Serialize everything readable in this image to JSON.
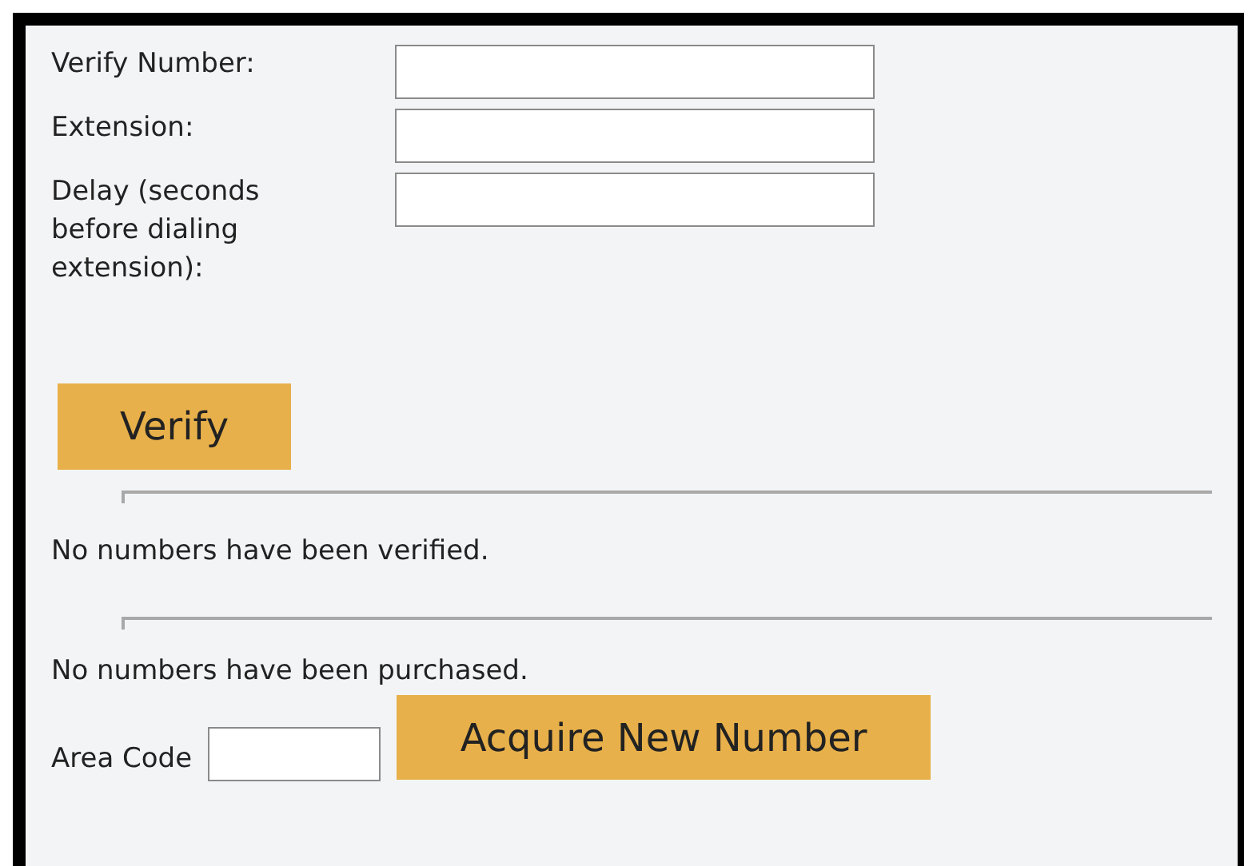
{
  "fields": [
    {
      "label": "Verify Number:"
    },
    {
      "label": "Extension:"
    },
    {
      "label": "Delay (seconds before dialing extension):"
    }
  ],
  "verify_button": "Verify",
  "verified_status": "No numbers have been verified.",
  "purchased_status": "No numbers have been purchased.",
  "area_code": {
    "label": "Area Code"
  },
  "acquire_button": "Acquire New Number"
}
